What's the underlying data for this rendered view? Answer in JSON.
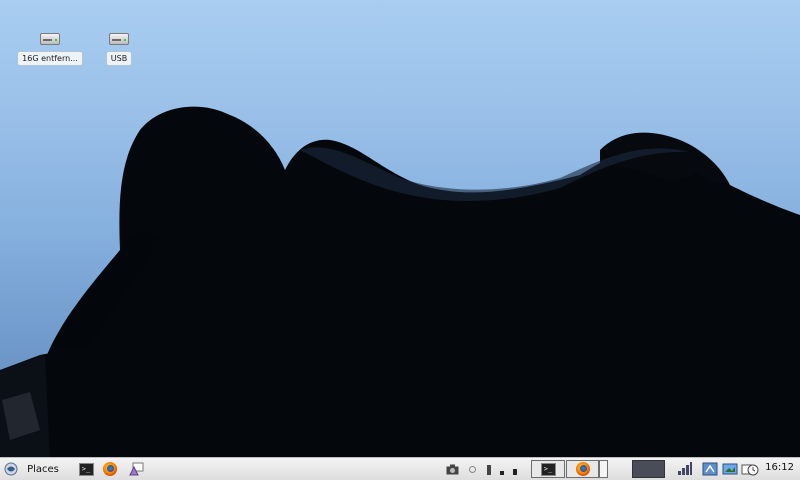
{
  "desktop": {
    "icons": [
      {
        "label": "16G entfern...",
        "icon": "drive-icon"
      },
      {
        "label": "USB",
        "icon": "drive-icon"
      }
    ]
  },
  "panel": {
    "menu_icon": "debian-menu-icon",
    "places_label": "Places",
    "launchers": [
      "terminal-icon",
      "firefox-icon",
      "display-settings-icon"
    ],
    "tray": [
      "screenshot-icon",
      "network-icon",
      "volume-icon",
      "battery-icon"
    ],
    "tasks": [
      {
        "icon": "terminal-icon"
      },
      {
        "icon": "firefox-icon"
      }
    ],
    "clock": "16:12"
  },
  "colors": {
    "sky": "#9cc2ea",
    "panel": "#e6e6e6"
  }
}
